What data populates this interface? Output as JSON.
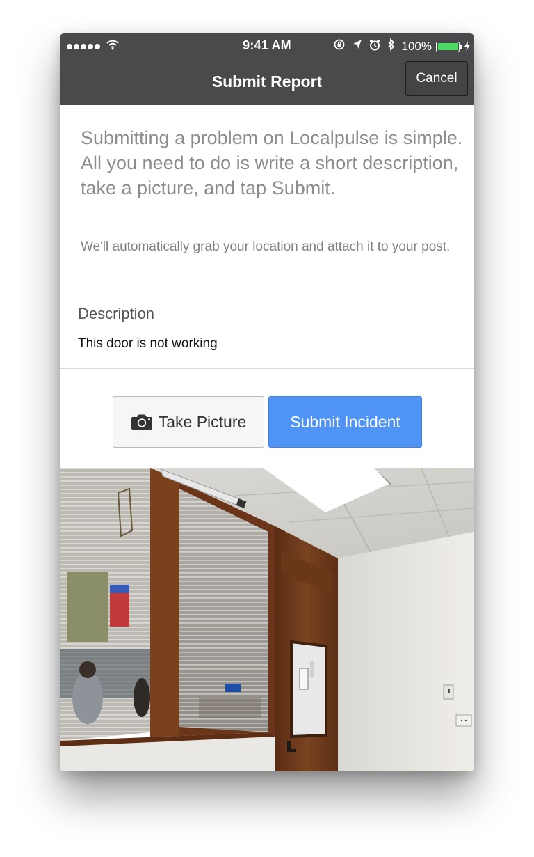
{
  "status_bar": {
    "time": "9:41 AM",
    "battery_percent": "100%",
    "icons": [
      "signal-dots-icon",
      "wifi-icon",
      "rotation-lock-icon",
      "location-arrow-icon",
      "alarm-clock-icon",
      "bluetooth-icon",
      "battery-icon",
      "charging-bolt-icon"
    ]
  },
  "nav": {
    "title": "Submit Report",
    "cancel_label": "Cancel"
  },
  "intro": {
    "lead": "Submitting a problem on Localpulse is simple. All you need to do is write a short description, take a picture, and tap Submit.",
    "note": "We'll automatically grab your location and attach it to your post."
  },
  "description": {
    "label": "Description",
    "value": "This door is not working"
  },
  "actions": {
    "take_picture_label": "Take Picture",
    "submit_label": "Submit Incident"
  },
  "photo": {
    "subject": "office-door-photo"
  },
  "colors": {
    "nav_background": "#4a4a4c",
    "primary_button": "#4f94f5",
    "battery": "#4cd964",
    "muted_text": "#8c8c8c"
  }
}
